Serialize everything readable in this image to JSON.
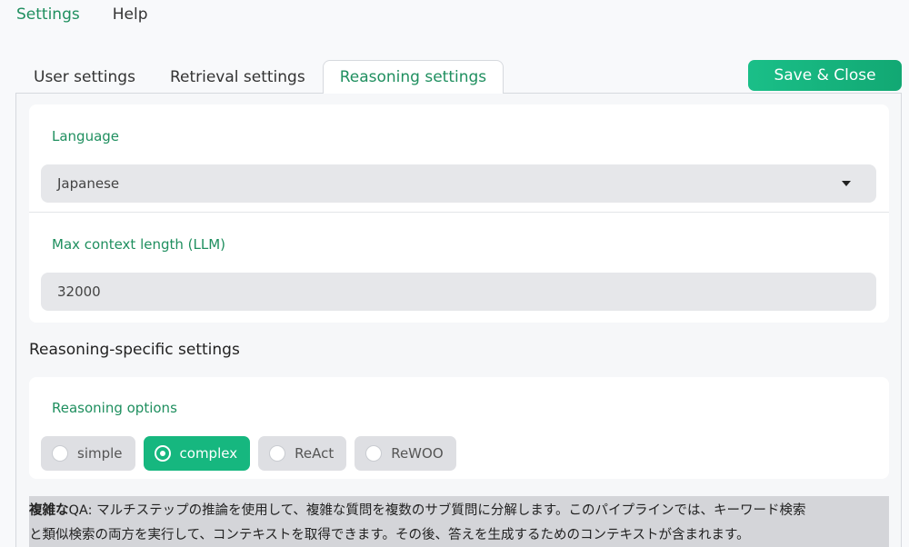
{
  "topnav": {
    "settings": "Settings",
    "help": "Help"
  },
  "tabs": [
    {
      "label": "User settings"
    },
    {
      "label": "Retrieval settings"
    },
    {
      "label": "Reasoning settings"
    }
  ],
  "save_button": "Save & Close",
  "language": {
    "label": "Language",
    "value": "Japanese"
  },
  "max_context": {
    "label": "Max context length (LLM)",
    "value": "32000"
  },
  "section_title": "Reasoning-specific settings",
  "reasoning_options": {
    "label": "Reasoning options",
    "options": [
      "simple",
      "complex",
      "ReAct",
      "ReWOO"
    ],
    "selected": "complex"
  },
  "description": {
    "bold": "複雑な",
    "line1": "QA: マルチステップの推論を使用して、複雑な質問を複数のサブ質問に分解します。このパイプラインでは、キーワード検索",
    "line2": "と類似検索の両方を実行して、コンテキストを取得できます。その後、答えを生成するためのコンテキストが含まれます。"
  },
  "colors": {
    "accent": "#1f8f5f",
    "button": "#16b77f"
  }
}
